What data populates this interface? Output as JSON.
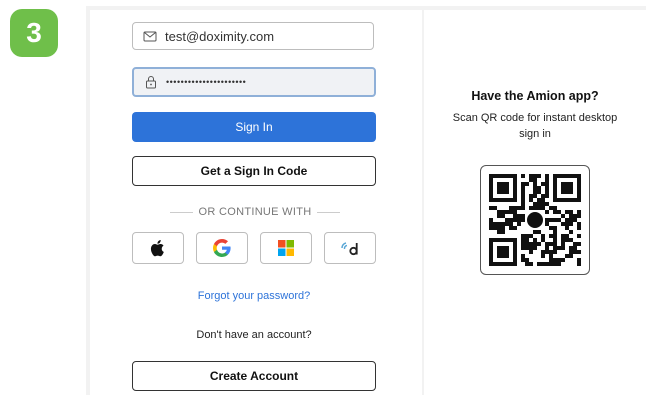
{
  "step": {
    "number": "3"
  },
  "login": {
    "email_value": "test@doximity.com",
    "password_value": "••••••••••••••••••••••",
    "sign_in_label": "Sign In",
    "sign_in_code_label": "Get a Sign In Code",
    "divider_text": "OR CONTINUE WITH",
    "social_buttons": [
      "apple-icon",
      "google-icon",
      "microsoft-icon",
      "doximity-icon"
    ],
    "forgot_password_label": "Forgot your password?",
    "no_account_text": "Don't have an account?",
    "create_account_label": "Create Account"
  },
  "app_promo": {
    "title": "Have the Amion app?",
    "subtitle": "Scan QR code for instant desktop sign in"
  },
  "colors": {
    "primary": "#2d73d9",
    "step_badge": "#6fbf4a"
  }
}
